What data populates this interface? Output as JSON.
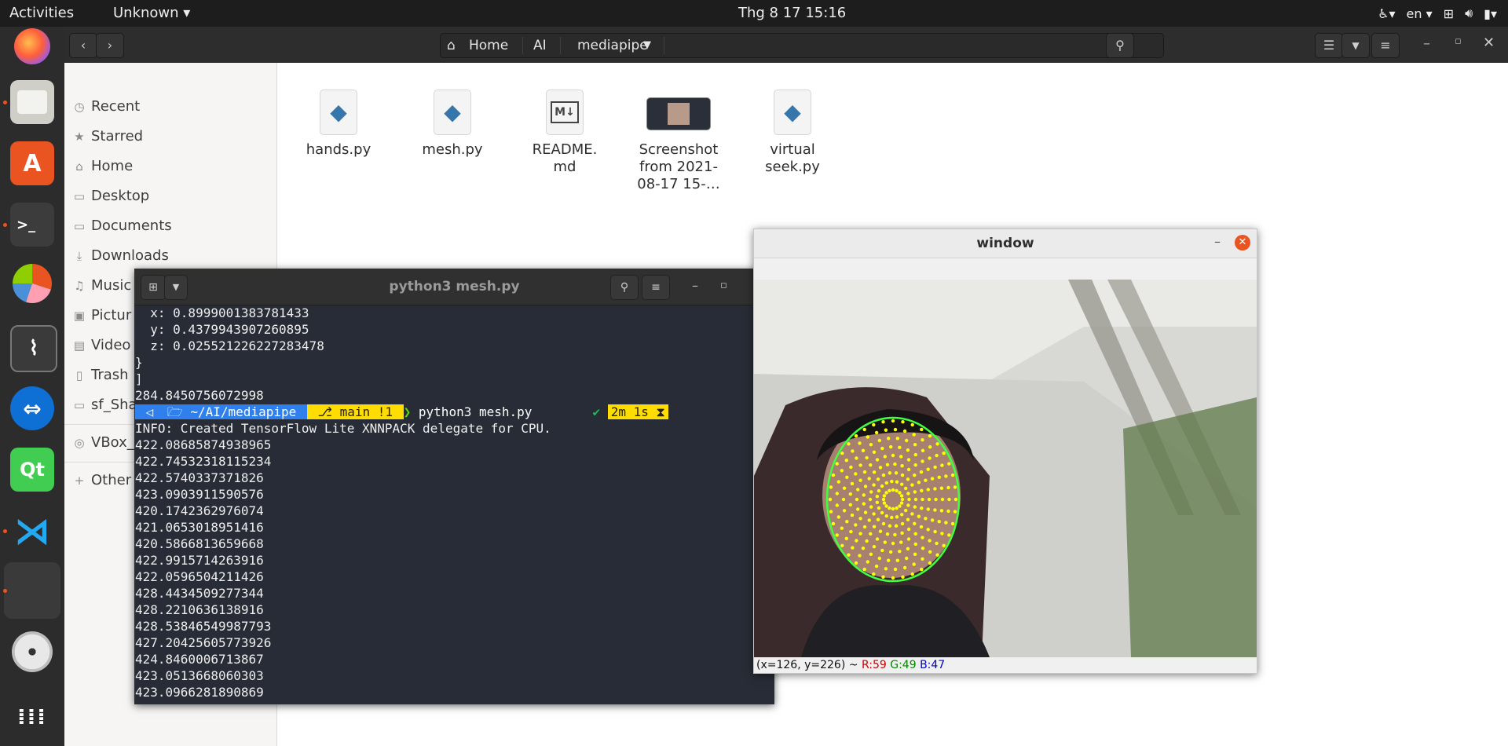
{
  "topbar": {
    "activities": "Activities",
    "app_menu": "Unknown",
    "clock": "Thg 8 17  15:16",
    "language": "en"
  },
  "dock": {
    "items": [
      "firefox-icon",
      "files-icon",
      "software-icon",
      "terminal-icon",
      "disk-usage-icon",
      "system-monitor-icon",
      "teamviewer-icon",
      "qt-creator-icon",
      "vscode-icon",
      "running-app-icon",
      "dvd-icon",
      "show-apps-icon"
    ]
  },
  "files": {
    "breadcrumbs": [
      "Home",
      "AI",
      "mediapipe"
    ],
    "sidebar": [
      {
        "label": "Recent",
        "icon": "clock-icon"
      },
      {
        "label": "Starred",
        "icon": "star-icon"
      },
      {
        "label": "Home",
        "icon": "home-icon"
      },
      {
        "label": "Desktop",
        "icon": "folder-icon"
      },
      {
        "label": "Documents",
        "icon": "folder-icon"
      },
      {
        "label": "Downloads",
        "icon": "download-icon"
      },
      {
        "label": "Music",
        "icon": "music-icon"
      },
      {
        "label": "Pictur",
        "icon": "image-icon"
      },
      {
        "label": "Video",
        "icon": "video-icon"
      },
      {
        "label": "Trash",
        "icon": "trash-icon"
      },
      {
        "label": "sf_Sha",
        "icon": "folder-icon"
      },
      {
        "label": "VBox_",
        "icon": "disc-icon"
      },
      {
        "label": "Other",
        "icon": "plus-icon"
      }
    ],
    "items": [
      {
        "name": "hands.py",
        "type": "python"
      },
      {
        "name": "mesh.py",
        "type": "python"
      },
      {
        "name": "README.\nmd",
        "type": "markdown"
      },
      {
        "name": "Screenshot\nfrom 2021-\n08-17 15-…",
        "type": "image"
      },
      {
        "name": "virtual\nseek.py",
        "type": "python"
      }
    ]
  },
  "terminal": {
    "title": "python3 mesh.py",
    "lines_before": [
      "  x: 0.8999001383781433",
      "  y: 0.4379943907260895",
      "  z: 0.025521226227283478",
      "}",
      "]",
      "284.8450756072998"
    ],
    "prompt": {
      "os": "",
      "dir": "~/AI/mediapipe",
      "git": "main !1",
      "command": "python3 mesh.py",
      "ok": "✔",
      "elapsed": "2m 1s"
    },
    "lines_after": [
      "INFO: Created TensorFlow Lite XNNPACK delegate for CPU.",
      "422.08685874938965",
      "422.74532318115234",
      "422.5740337371826",
      "423.0903911590576",
      "420.1742362976074",
      "421.0653018951416",
      "420.5866813659668",
      "422.9915714263916",
      "422.0596504211426",
      "428.4434509277344",
      "428.2210636138916",
      "428.53846549987793",
      "427.20425605773926",
      "424.8460006713867",
      "423.0513668060303",
      "423.0966281890869"
    ]
  },
  "cv_window": {
    "title": "window",
    "status_coords": "(x=126, y=226) ~",
    "status_r": "R:59",
    "status_g": "G:49",
    "status_b": "B:47",
    "status_r_color": "#cc0000",
    "status_g_color": "#008800",
    "status_b_color": "#0000cc"
  },
  "colors": {
    "accent": "#e95420",
    "mesh_outline": "#40ff40",
    "mesh_points": "#ffff00"
  }
}
